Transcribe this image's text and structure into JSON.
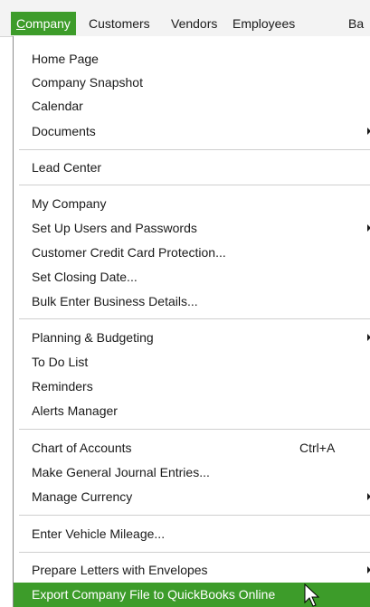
{
  "menubar": {
    "items": [
      {
        "label": "Company",
        "active": true
      },
      {
        "label": "Customers"
      },
      {
        "label": "Vendors"
      },
      {
        "label": "Employees"
      },
      {
        "label": "Ba"
      }
    ]
  },
  "menu": {
    "items": [
      {
        "label": "Home Page"
      },
      {
        "label": "Company Snapshot"
      },
      {
        "label": "Calendar"
      },
      {
        "label": "Documents",
        "submenu": true
      },
      {
        "label": "Lead Center"
      },
      {
        "label": "My Company"
      },
      {
        "label": "Set Up Users and Passwords",
        "submenu": true
      },
      {
        "label": "Customer Credit Card Protection..."
      },
      {
        "label": "Set Closing Date..."
      },
      {
        "label": "Bulk Enter Business Details..."
      },
      {
        "label": "Planning & Budgeting",
        "submenu": true
      },
      {
        "label": "To Do List"
      },
      {
        "label": "Reminders"
      },
      {
        "label": "Alerts Manager"
      },
      {
        "label": "Chart of Accounts",
        "shortcut": "Ctrl+A"
      },
      {
        "label": "Make General Journal Entries..."
      },
      {
        "label": "Manage Currency",
        "submenu": true
      },
      {
        "label": "Enter Vehicle Mileage..."
      },
      {
        "label": "Prepare Letters with Envelopes",
        "submenu": true
      },
      {
        "label": "Export Company File to QuickBooks Online",
        "highlighted": true
      }
    ]
  },
  "colors": {
    "accent": "#3d9c2a",
    "highlight_text": "#ffffff"
  }
}
